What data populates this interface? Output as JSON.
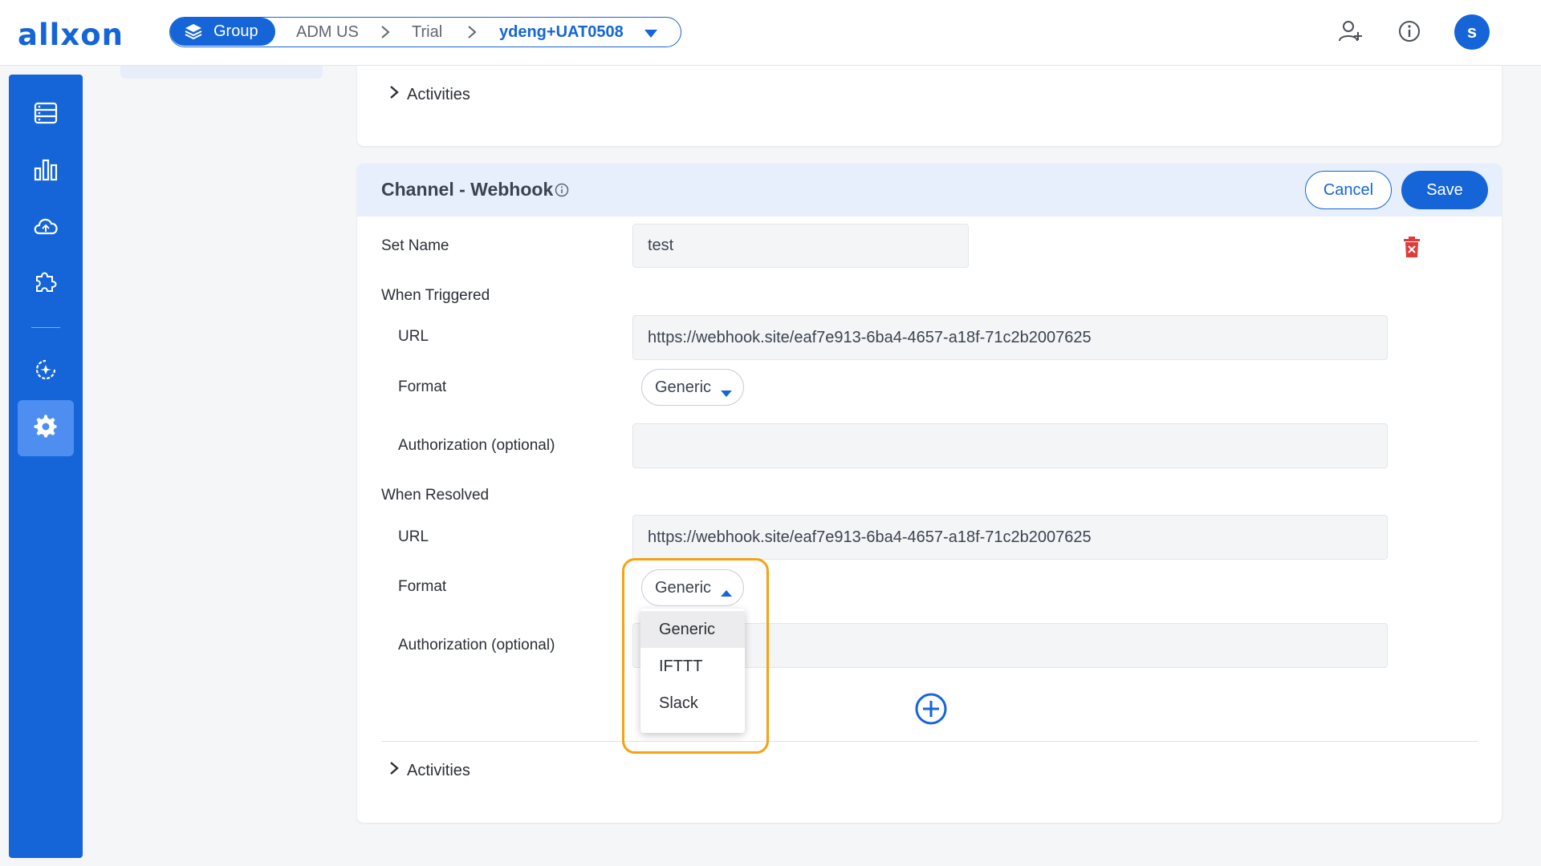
{
  "app": {
    "logo": "allxon",
    "avatar_letter": "s"
  },
  "breadcrumb": {
    "group_label": "Group",
    "items": [
      "ADM US",
      "Trial"
    ],
    "current": "ydeng+UAT0508"
  },
  "top_activities": {
    "label": "Activities"
  },
  "channel": {
    "title": "Channel - Webhook",
    "cancel_label": "Cancel",
    "save_label": "Save",
    "set_name_label": "Set Name",
    "set_name_value": "test",
    "when_triggered": {
      "heading": "When Triggered",
      "url_label": "URL",
      "url_value": "https://webhook.site/eaf7e913-6ba4-4657-a18f-71c2b2007625",
      "format_label": "Format",
      "format_value": "Generic",
      "auth_label": "Authorization (optional)",
      "auth_value": ""
    },
    "when_resolved": {
      "heading": "When Resolved",
      "url_label": "URL",
      "url_value": "https://webhook.site/eaf7e913-6ba4-4657-a18f-71c2b2007625",
      "format_label": "Format",
      "format_value": "Generic",
      "auth_label": "Authorization (optional)",
      "auth_value": ""
    },
    "format_options": [
      "Generic",
      "IFTTT",
      "Slack"
    ],
    "activities_label": "Activities"
  },
  "colors": {
    "brand": "#1565d8",
    "highlight": "#f5a312",
    "danger": "#e03b3b"
  }
}
